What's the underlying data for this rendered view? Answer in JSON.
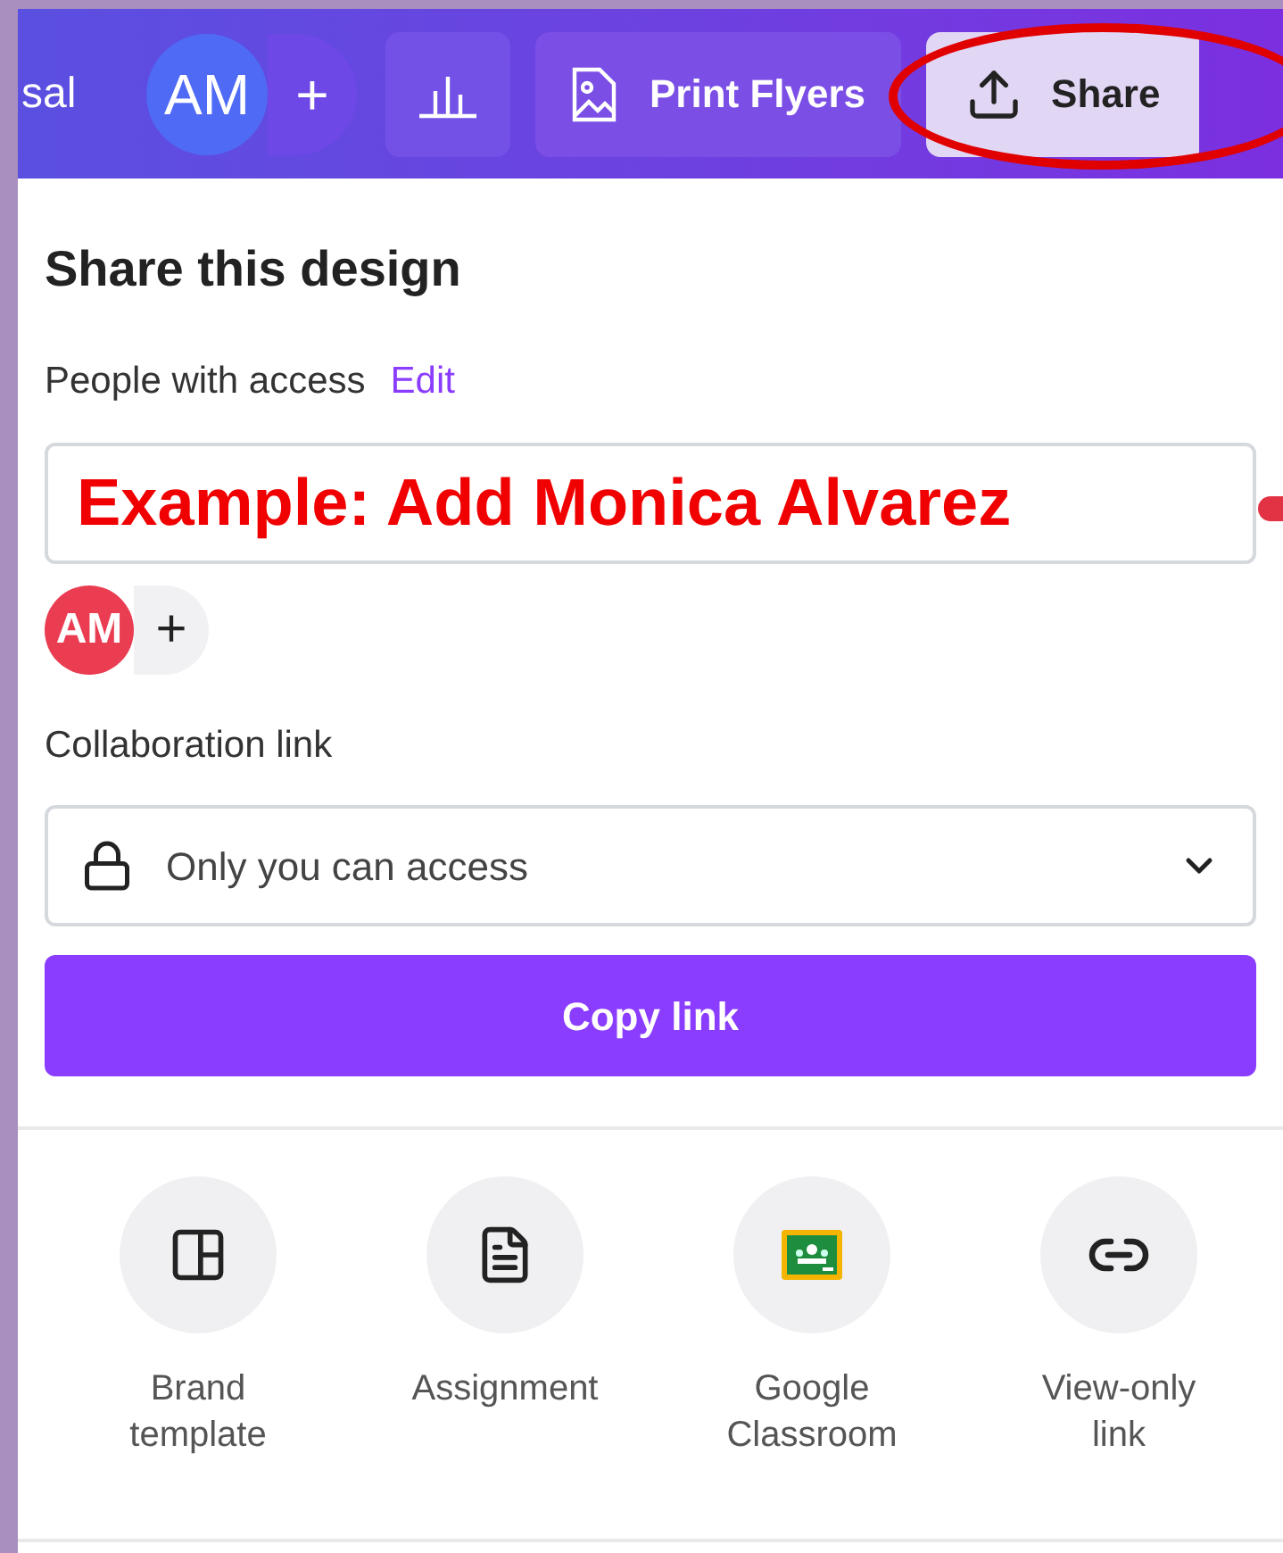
{
  "topbar": {
    "cut_label": "sal",
    "avatar": {
      "initials": "AM"
    },
    "add_symbol": "+",
    "print_button": "Print Flyers",
    "share_button": "Share"
  },
  "panel": {
    "title": "Share this design",
    "people_label": "People with access",
    "edit_link": "Edit",
    "annotation": "Example: Add Monica Alvarez",
    "avatar": {
      "initials": "AM"
    },
    "add_symbol": "+",
    "collab_label": "Collaboration link",
    "access_select": "Only you can access",
    "copy_button": "Copy link",
    "options": [
      {
        "kind": "brand",
        "label": "Brand template"
      },
      {
        "kind": "assignment",
        "label": "Assignment"
      },
      {
        "kind": "classroom",
        "label": "Google Classroom"
      },
      {
        "kind": "link",
        "label": "View-only link"
      }
    ]
  }
}
